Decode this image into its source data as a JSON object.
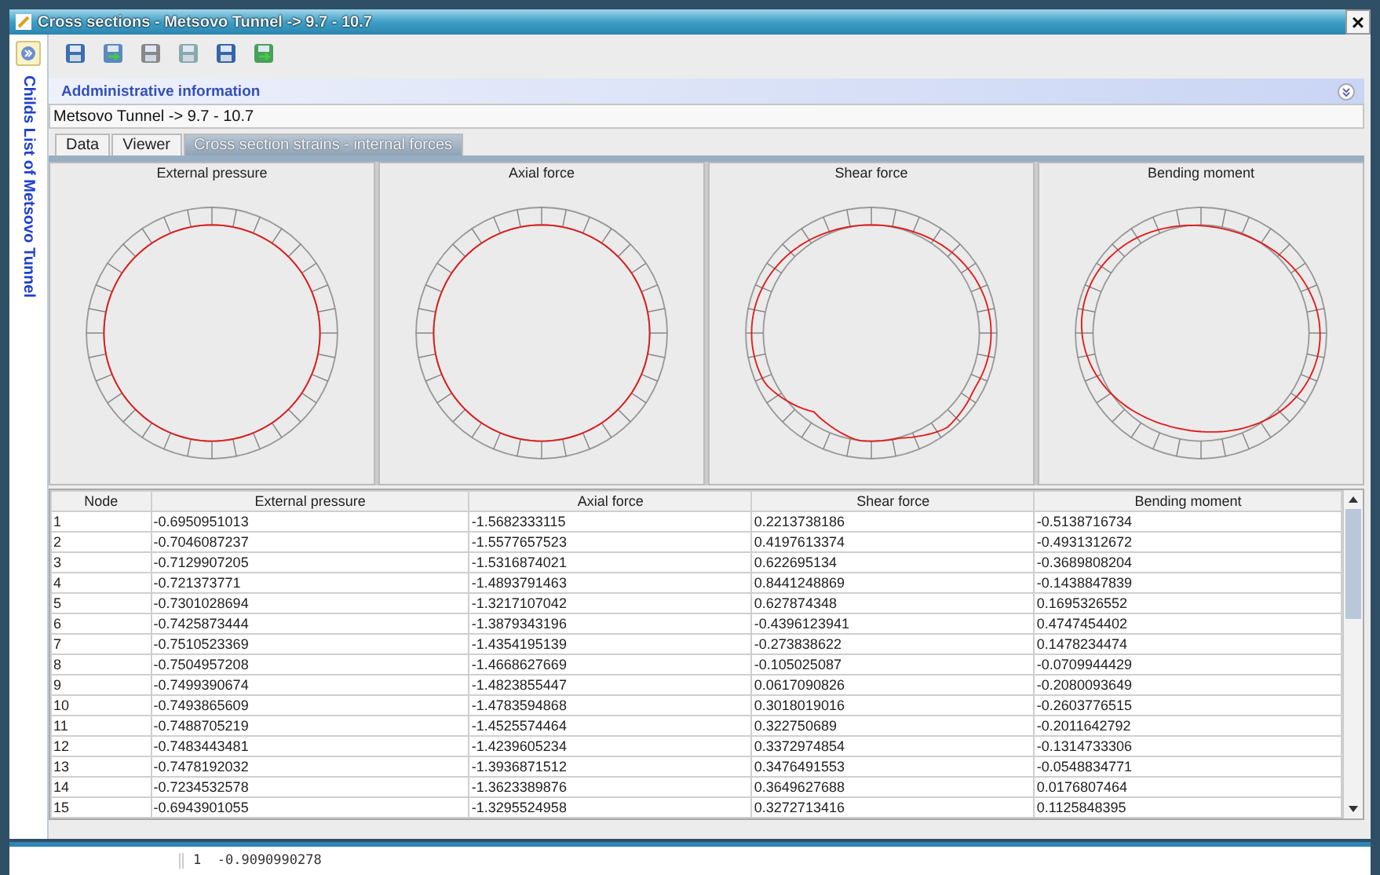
{
  "window": {
    "title": "Cross sections - Metsovo Tunnel -> 9.7 - 10.7",
    "close": "×"
  },
  "sidebar": {
    "label": "Childs List of Metsovo Tunnel"
  },
  "section": {
    "title": "Addministrative information"
  },
  "path_field": {
    "value": "Metsovo Tunnel -> 9.7 - 10.7"
  },
  "tabs": [
    {
      "label": "Data",
      "selected": false
    },
    {
      "label": "Viewer",
      "selected": false
    },
    {
      "label": "Cross section strains - internal forces",
      "selected": true
    }
  ],
  "diagrams": [
    {
      "title": "External pressure",
      "kind": "uniform"
    },
    {
      "title": "Axial force",
      "kind": "uniform"
    },
    {
      "title": "Shear force",
      "kind": "irregular"
    },
    {
      "title": "Bending moment",
      "kind": "bulged"
    }
  ],
  "table": {
    "columns": [
      "Node",
      "External pressure",
      "Axial force",
      "Shear force",
      "Bending moment"
    ],
    "rows": [
      [
        "1",
        "-0.6950951013",
        "-1.5682333115",
        "0.2213738186",
        "-0.5138716734"
      ],
      [
        "2",
        "-0.7046087237",
        "-1.5577657523",
        "0.4197613374",
        "-0.4931312672"
      ],
      [
        "3",
        "-0.7129907205",
        "-1.5316874021",
        "0.622695134",
        "-0.3689808204"
      ],
      [
        "4",
        "-0.721373771",
        "-1.4893791463",
        "0.8441248869",
        "-0.1438847839"
      ],
      [
        "5",
        "-0.7301028694",
        "-1.3217107042",
        "0.627874348",
        "0.1695326552"
      ],
      [
        "6",
        "-0.7425873444",
        "-1.3879343196",
        "-0.4396123941",
        "0.4747454402"
      ],
      [
        "7",
        "-0.7510523369",
        "-1.4354195139",
        "-0.273838622",
        "0.1478234474"
      ],
      [
        "8",
        "-0.7504957208",
        "-1.4668627669",
        "-0.105025087",
        "-0.0709944429"
      ],
      [
        "9",
        "-0.7499390674",
        "-1.4823855447",
        "0.0617090826",
        "-0.2080093649"
      ],
      [
        "10",
        "-0.7493865609",
        "-1.4783594868",
        "0.3018019016",
        "-0.2603776515"
      ],
      [
        "11",
        "-0.7488705219",
        "-1.4525574464",
        "0.322750689",
        "-0.2011642792"
      ],
      [
        "12",
        "-0.7483443481",
        "-1.4239605234",
        "0.3372974854",
        "-0.1314733306"
      ],
      [
        "13",
        "-0.7478192032",
        "-1.3936871512",
        "0.3476491553",
        "-0.0548834771"
      ],
      [
        "14",
        "-0.7234532578",
        "-1.3623389876",
        "0.3649627688",
        "0.0176807464"
      ],
      [
        "15",
        "-0.6943901055",
        "-1.3295524958",
        "0.3272713416",
        "0.1125848395"
      ]
    ]
  },
  "console": {
    "line": "1  -0.9090990278"
  }
}
